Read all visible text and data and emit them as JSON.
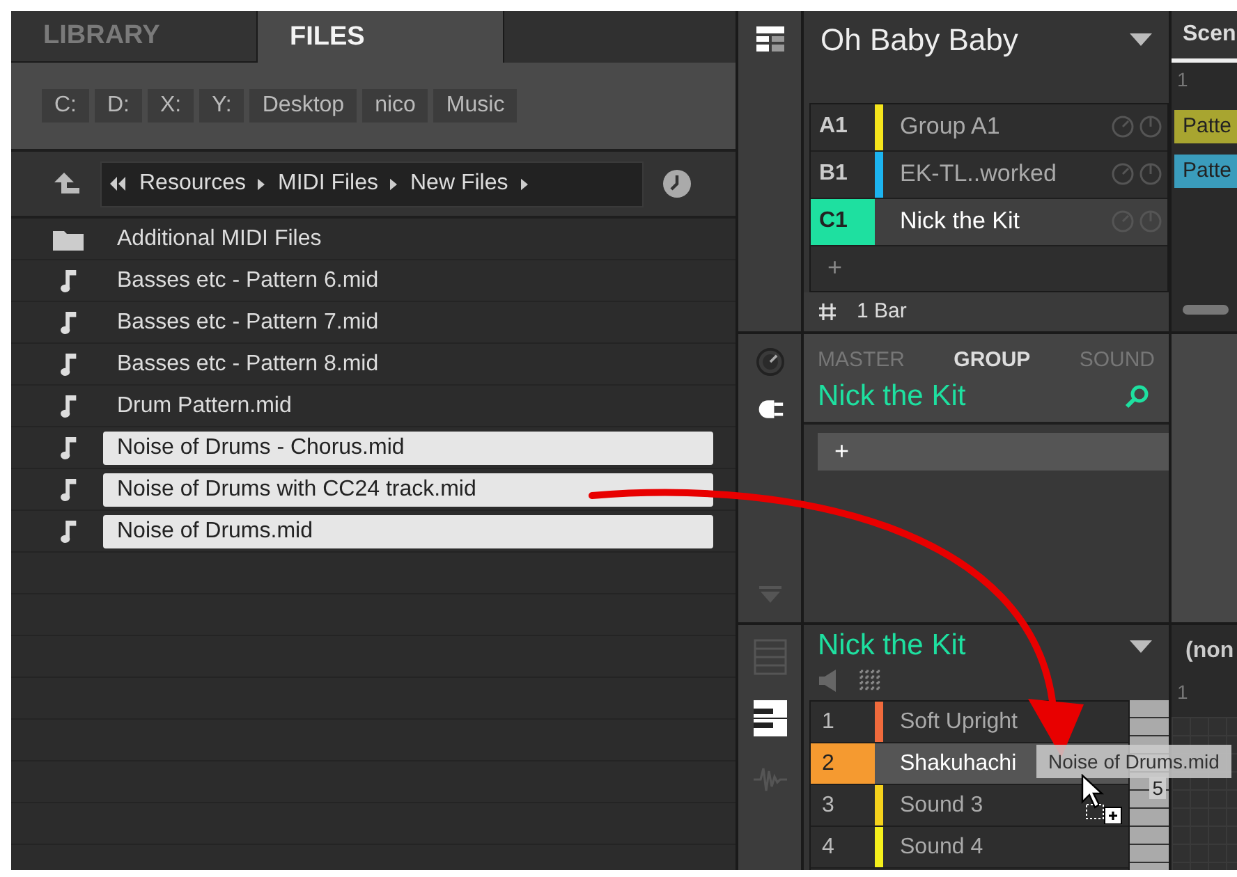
{
  "browser": {
    "tabs": [
      {
        "label": "LIBRARY",
        "selected": false
      },
      {
        "label": "FILES",
        "selected": true
      }
    ],
    "locations": [
      "C:",
      "D:",
      "X:",
      "Y:",
      "Desktop",
      "nico",
      "Music"
    ],
    "path": [
      "Resources",
      "MIDI Files",
      "New Files"
    ],
    "files": [
      {
        "name": "Additional MIDI Files",
        "kind": "folder",
        "selected": false
      },
      {
        "name": "Basses etc - Pattern 6.mid",
        "kind": "midi",
        "selected": false
      },
      {
        "name": "Basses etc - Pattern 7.mid",
        "kind": "midi",
        "selected": false
      },
      {
        "name": "Basses etc - Pattern 8.mid",
        "kind": "midi",
        "selected": false
      },
      {
        "name": "Drum Pattern.mid",
        "kind": "midi",
        "selected": false
      },
      {
        "name": "Noise of Drums - Chorus.mid",
        "kind": "midi",
        "selected": true
      },
      {
        "name": "Noise of Drums with CC24 track.mid",
        "kind": "midi",
        "selected": true
      },
      {
        "name": "Noise of Drums.mid",
        "kind": "midi",
        "selected": true
      }
    ]
  },
  "arranger": {
    "project": "Oh Baby Baby",
    "groups": [
      {
        "slot": "A1",
        "name": "Group A1",
        "color": "#f5e51c",
        "selected": false
      },
      {
        "slot": "B1",
        "name": "EK-TL..worked",
        "color": "#1cb4f0",
        "selected": false
      },
      {
        "slot": "C1",
        "name": "Nick the Kit",
        "color": "#1ee0a0",
        "selected": true
      }
    ],
    "add": "+",
    "pattern_length": "1 Bar",
    "scene": {
      "label": "Scen",
      "column": "1",
      "patterns": [
        {
          "label": "Patte",
          "color": "#a8a530"
        },
        {
          "label": "Patte",
          "color": "#3a9cbc"
        }
      ]
    }
  },
  "control": {
    "tabs": [
      {
        "label": "MASTER",
        "selected": false
      },
      {
        "label": "GROUP",
        "selected": true
      },
      {
        "label": "SOUND",
        "selected": false
      }
    ],
    "title": "Nick the Kit",
    "add": "+"
  },
  "pattern_editor": {
    "group": "Nick the Kit",
    "sounds": [
      {
        "slot": "1",
        "name": "Soft Upright",
        "color": "#f06a3c",
        "selected": false
      },
      {
        "slot": "2",
        "name": "Shakuhachi",
        "color": "#f59a30",
        "selected": true
      },
      {
        "slot": "3",
        "name": "Sound 3",
        "color": "#f5d21c",
        "selected": false
      },
      {
        "slot": "4",
        "name": "Sound 4",
        "color": "#f5f01c",
        "selected": false
      }
    ],
    "key_label": "5",
    "pattern": "(non",
    "step": "1"
  },
  "drag": {
    "label": "Noise of Drums.mid"
  }
}
